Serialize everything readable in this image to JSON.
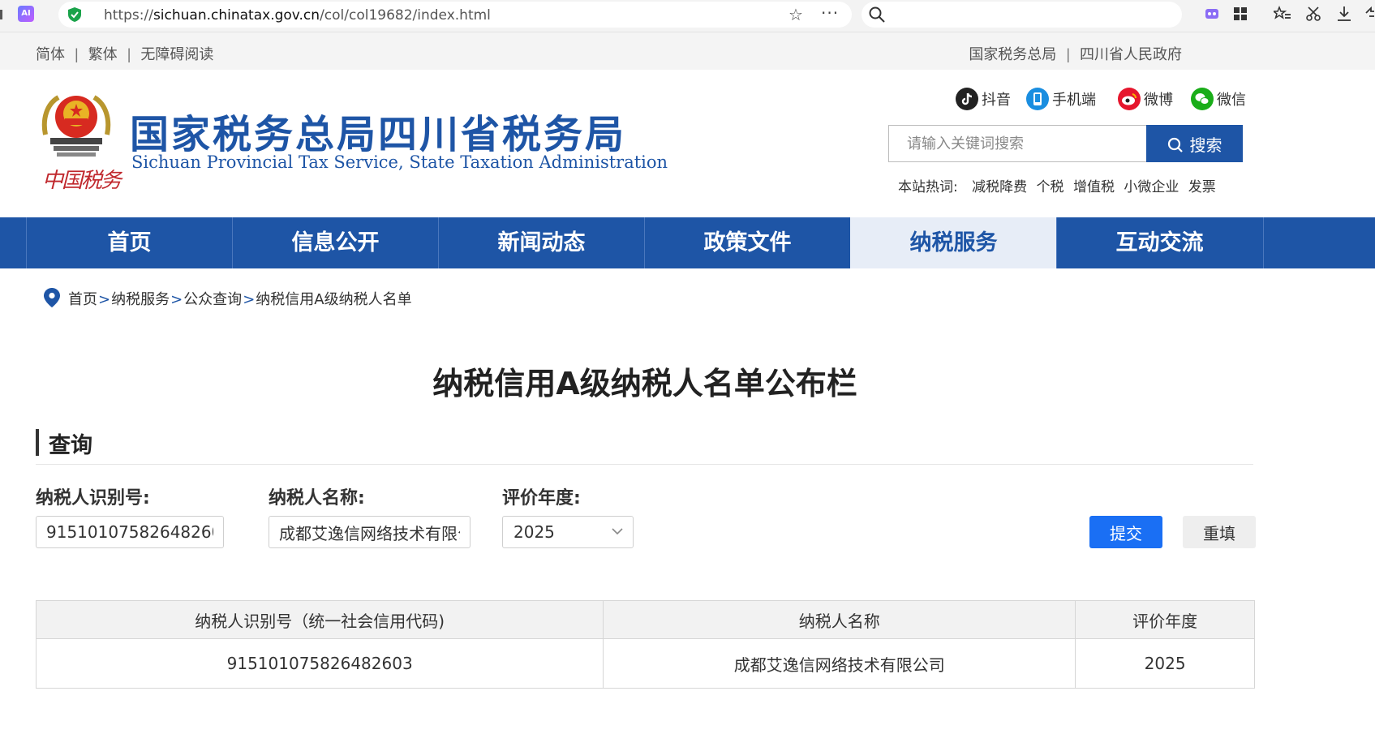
{
  "browser": {
    "url_prefix": "https://",
    "url_host": "sichuan.chinatax.gov.cn",
    "url_path": "/col/col19682/index.html",
    "ai_badge": "AI"
  },
  "util": {
    "lang_simplified": "简体",
    "lang_traditional": "繁体",
    "accessible": "无障碍阅读",
    "link_sat": "国家税务总局",
    "link_gov": "四川省人民政府",
    "sep": "|"
  },
  "header": {
    "title": "国家税务总局四川省税务局",
    "subtitle": "Sichuan Provincial Tax Service, State Taxation Administration",
    "seal_text": "中国税务",
    "social": [
      {
        "label": "抖音",
        "icon": "douyin-icon"
      },
      {
        "label": "手机端",
        "icon": "mobile-icon"
      },
      {
        "label": "微博",
        "icon": "weibo-icon"
      },
      {
        "label": "微信",
        "icon": "wechat-icon"
      }
    ],
    "search_placeholder": "请输入关键词搜索",
    "search_button": "搜索",
    "hot_label": "本站热词:",
    "hot_words": [
      "减税降费",
      "个税",
      "增值税",
      "小微企业",
      "发票"
    ]
  },
  "nav": {
    "items": [
      "首页",
      "信息公开",
      "新闻动态",
      "政策文件",
      "纳税服务",
      "互动交流"
    ],
    "active": "纳税服务"
  },
  "breadcrumb": [
    "首页",
    "纳税服务",
    "公众查询",
    "纳税信用A级纳税人名单"
  ],
  "breadcrumb_sep": ">",
  "main": {
    "title": "纳税信用A级纳税人名单公布栏",
    "section": "查询",
    "form": {
      "id_label": "纳税人识别号:",
      "id_value": "915101075826482603",
      "name_label": "纳税人名称:",
      "name_value": "成都艾逸信网络技术有限公司",
      "year_label": "评价年度:",
      "year_value": "2025",
      "submit": "提交",
      "reset": "重填"
    },
    "table": {
      "headers": [
        "纳税人识别号（统一社会信用代码)",
        "纳税人名称",
        "评价年度"
      ],
      "rows": [
        [
          "915101075826482603",
          "成都艾逸信网络技术有限公司",
          "2025"
        ]
      ]
    }
  },
  "colors": {
    "brand_blue": "#1e55a6",
    "submit_blue": "#1a6ff4",
    "nav_active_bg": "#e7edf7",
    "seal_red": "#c0282d"
  }
}
